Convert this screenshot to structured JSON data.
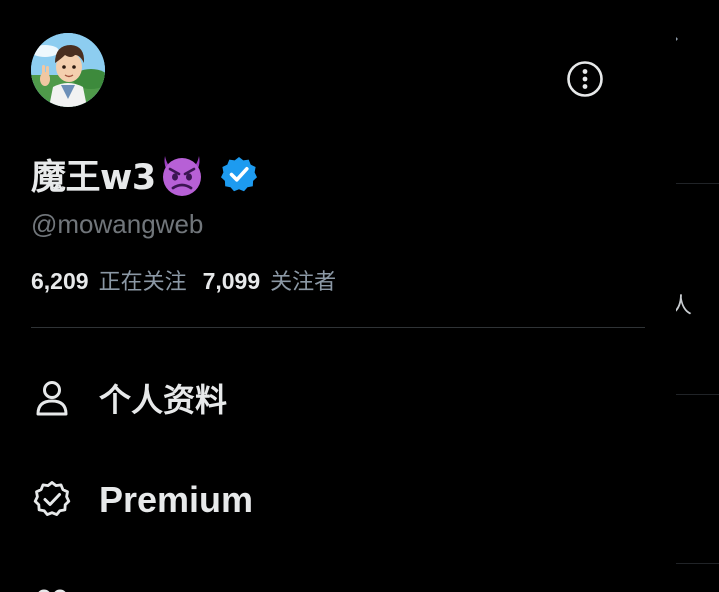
{
  "profile": {
    "display_name": "魔王w3",
    "handle": "@mowangweb",
    "following_count": "6,209",
    "following_label": "正在关注",
    "followers_count": "7,099",
    "followers_label": "关注者",
    "verified": true
  },
  "menu": {
    "items": [
      {
        "label": "个人资料",
        "icon": "person-icon"
      },
      {
        "label": "Premium",
        "icon": "premium-badge-icon"
      }
    ]
  },
  "background": {
    "partial_text": "人"
  },
  "colors": {
    "background": "#000000",
    "primary_text": "#e7e9ea",
    "secondary_text": "#71767b",
    "verified_blue": "#1d9bf0",
    "separator": "#2f3336",
    "devil_purple": "#b760d6"
  }
}
